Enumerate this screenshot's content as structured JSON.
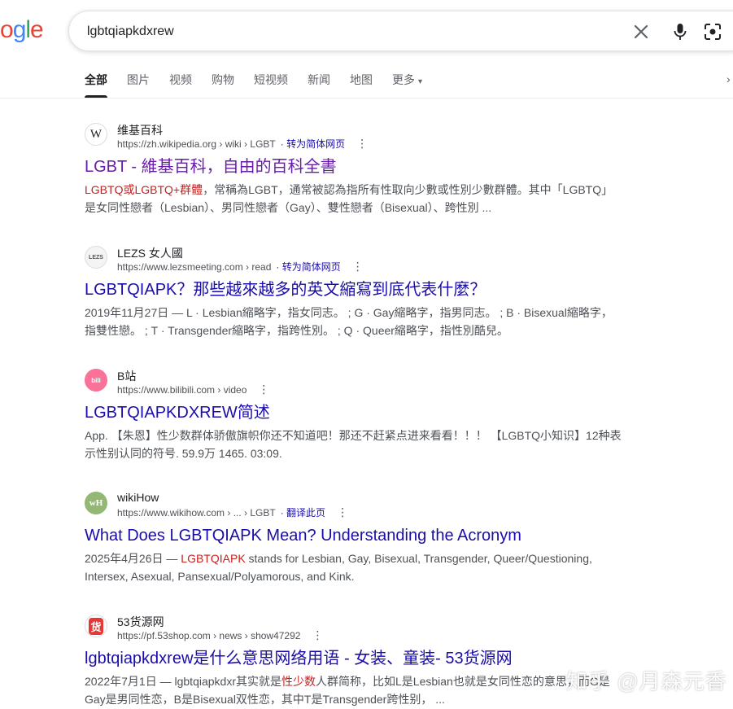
{
  "logo": {
    "part1": "o",
    "part2": "g",
    "part3": "l",
    "part4": "e"
  },
  "search": {
    "query": "lgbtqiapkdxrew"
  },
  "tabs": [
    {
      "label": "全部",
      "active": true
    },
    {
      "label": "图片"
    },
    {
      "label": "视频"
    },
    {
      "label": "购物"
    },
    {
      "label": "短视频"
    },
    {
      "label": "新闻"
    },
    {
      "label": "地图"
    },
    {
      "label": "更多"
    }
  ],
  "results": [
    {
      "site": "维基百科",
      "favicon": "W",
      "url": "https://zh.wikipedia.org › wiki › LGBT",
      "translate": "· 转为简体网页",
      "title": "LGBT - 維基百科，自由的百科全書",
      "snippet_hl": "LGBTQ或LGBTQ+群體",
      "snippet": "，常稱為LGBT，通常被認為指所有性取向少數或性別少數群體。其中「LGBTQ」是女同性戀者（Lesbian）、男同性戀者（Gay）、雙性戀者（Bisexual）、跨性別 ..."
    },
    {
      "site": "LEZS 女人國",
      "favicon": "LEZS",
      "url": "https://www.lezsmeeting.com › read",
      "translate": "· 转为简体网页",
      "title": "LGBTQIAPK？那些越來越多的英文縮寫到底代表什麼？",
      "snippet": "2019年11月27日 — L · Lesbian縮略字，指女同志。 ; G · Gay縮略字，指男同志。 ; B · Bisexual縮略字，指雙性戀。 ; T · Transgender縮略字，指跨性別。 ; Q · Queer縮略字，指性別酷兒。"
    },
    {
      "site": "B站",
      "favicon": "bili",
      "url": "https://www.bilibili.com › video",
      "title": "LGBTQIAPKDXREW简述",
      "snippet": "App. 【朱恩】性少数群体骄傲旗帜你还不知道吧！那还不赶紧点进来看看！！！ 【LGBTQ小知识】12种表示性别认同的符号. 59.9万 1465. 03:09."
    },
    {
      "site": "wikiHow",
      "favicon": "wH",
      "url": "https://www.wikihow.com › ... › LGBT",
      "translate": "· 翻译此页",
      "title": "What Does LGBTQIAPK Mean? Understanding the Acronym",
      "snippet_pre": "2025年4月26日 — ",
      "snippet_hl": "LGBTQIAPK",
      "snippet": " stands for Lesbian, Gay, Bisexual, Transgender, Queer/Questioning, Intersex, Asexual, Pansexual/Polyamorous, and Kink."
    },
    {
      "site": "53货源网",
      "favicon": "货",
      "url": "https://pf.53shop.com › news › show47292",
      "title": "lgbtqiapkdxrew是什么意思网络用语 - 女装、童装- 53货源网",
      "snippet_pre": "2022年7月1日 — lgbtqiapkdxr其实就是",
      "snippet_hl": "性少数",
      "snippet": "人群简称，比如L是Lesbian也就是女同性恋的意思，而G是Gay是男同性恋，B是Bisexual双性恋，其中T是Transgender跨性别， ..."
    }
  ],
  "watermark": "知乎 @月森元香"
}
